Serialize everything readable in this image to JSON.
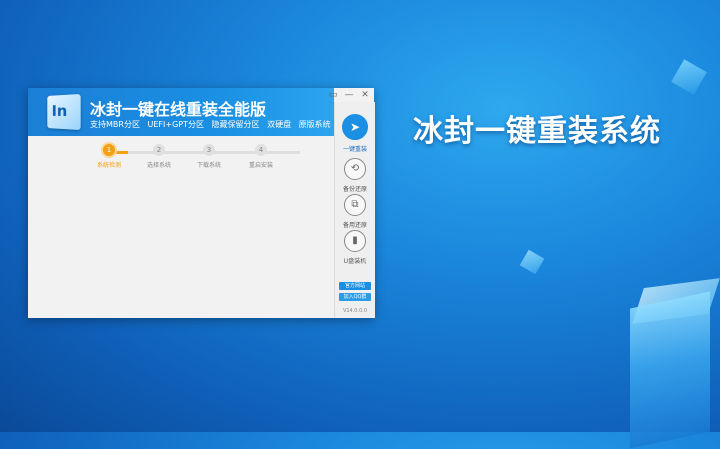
{
  "hero": {
    "title": "冰封一键重装系统"
  },
  "app": {
    "logo_text": "In",
    "title": "冰封一键在线重装全能版",
    "features": [
      "支持MBR分区",
      "UEFI+GPT分区",
      "隐藏保留分区",
      "双硬盘",
      "原版系统"
    ],
    "window_controls": {
      "menu": "▭",
      "minimize": "—",
      "close": "✕"
    },
    "steps": [
      {
        "num": "1",
        "label": "系统检测"
      },
      {
        "num": "2",
        "label": "选择系统"
      },
      {
        "num": "3",
        "label": "下载系统"
      },
      {
        "num": "4",
        "label": "重启安装"
      }
    ],
    "active_step": 1,
    "sidebar": {
      "items": [
        {
          "icon": "➤",
          "icon_name": "cursor-icon",
          "label": "一键重装"
        },
        {
          "icon": "⟲",
          "icon_name": "backup-restore-icon",
          "label": "备份还原"
        },
        {
          "icon": "⧉",
          "icon_name": "spare-restore-icon",
          "label": "备用还原"
        },
        {
          "icon": "▮",
          "icon_name": "usb-icon",
          "label": "U盘装机"
        }
      ],
      "links": {
        "website": "官方网站",
        "qq": "加入QQ群"
      },
      "version": "V14.0.0.0"
    },
    "colors": {
      "accent": "#1a8fe3",
      "step_active": "#f3a014"
    }
  }
}
